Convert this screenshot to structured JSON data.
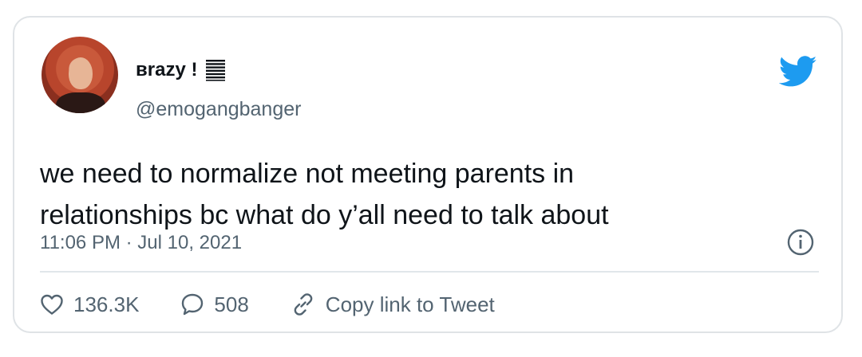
{
  "author": {
    "display_name": "вrazy !",
    "handle": "@emogangbanger",
    "avatar": "profile-photo",
    "name_badge_icon": "striped-lines-icon"
  },
  "tweet": {
    "text_line1": "we need to normalize not meeting parents in",
    "text_line2": "relationships bc what do y’all need to talk about",
    "timestamp": "11:06 PM · Jul 10, 2021"
  },
  "actions": {
    "likes": "136.3K",
    "replies": "508",
    "copy_link_label": "Copy link to Tweet"
  },
  "icons": {
    "brand": "twitter-bird-icon",
    "info": "info-icon",
    "like": "heart-icon",
    "reply": "speech-bubble-icon",
    "copy": "link-icon"
  },
  "colors": {
    "twitter_blue": "#1d9bf0",
    "secondary_text": "#536471",
    "border": "#dfe3e6"
  }
}
